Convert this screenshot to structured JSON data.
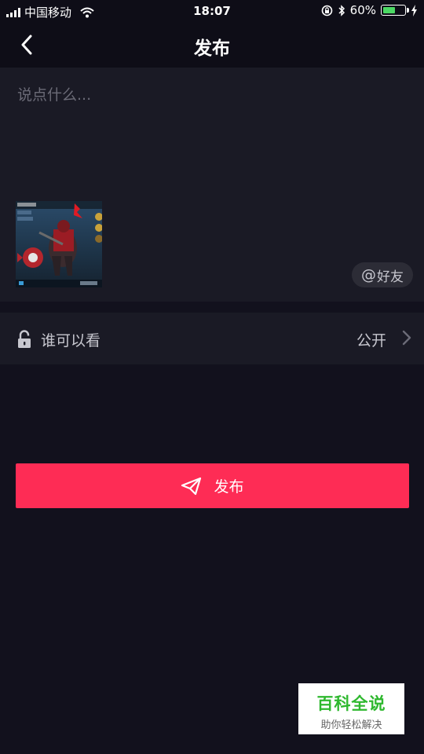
{
  "status_bar": {
    "carrier": "中国移动",
    "time": "18:07",
    "battery_percent": "60%",
    "battery_level": 0.6,
    "icons": [
      "signal-icon",
      "wifi-icon",
      "rotation-lock-icon",
      "bluetooth-icon",
      "battery-icon",
      "charging-icon"
    ]
  },
  "header": {
    "title": "发布",
    "back_icon": "chevron-left-icon"
  },
  "compose": {
    "placeholder": "说点什么...",
    "value": "",
    "mention_at": "@",
    "mention_label": "好友"
  },
  "visibility": {
    "label": "谁可以看",
    "value": "公开",
    "icon": "unlock-icon"
  },
  "publish": {
    "label": "发布",
    "icon": "paper-plane-icon"
  },
  "colors": {
    "background": "#12111d",
    "panel": "#1a1a25",
    "accent": "#fe2c55",
    "battery": "#4cd964"
  },
  "watermark": {
    "title": "百科全说",
    "subtitle": "助你轻松解决"
  }
}
